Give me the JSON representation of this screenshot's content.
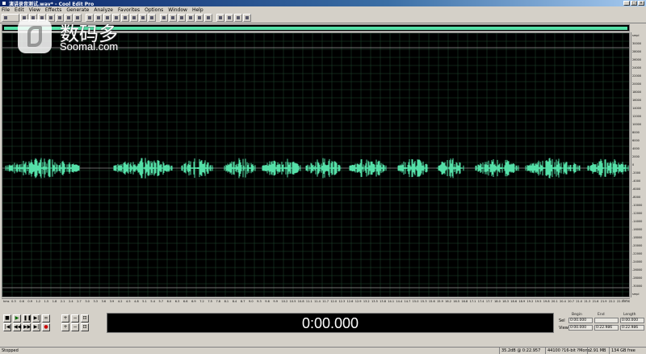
{
  "window": {
    "title": "演讲录音测试.wav* - Cool Edit Pro",
    "min_label": "_",
    "max_label": "□",
    "close_label": "×"
  },
  "menu": [
    "File",
    "Edit",
    "View",
    "Effects",
    "Generate",
    "Analyze",
    "Favorites",
    "Options",
    "Window",
    "Help"
  ],
  "watermark": {
    "brand_cn": "数码多",
    "brand_en": "Soomal.com"
  },
  "colors": {
    "waveform": "#55e0a8",
    "background": "#000000",
    "grid": "#1f4a2e",
    "center_line": "#cfcfcf"
  },
  "vertical_ruler": {
    "ticks": [
      "smpl",
      "30000",
      "28000",
      "26000",
      "24000",
      "22000",
      "20000",
      "18000",
      "16000",
      "14000",
      "12000",
      "10000",
      "8000",
      "6000",
      "4000",
      "2000",
      "0",
      "-2000",
      "-4000",
      "-6000",
      "-8000",
      "-10000",
      "-12000",
      "-14000",
      "-16000",
      "-18000",
      "-20000",
      "-22000",
      "-24000",
      "-26000",
      "-28000",
      "-30000",
      "smpl"
    ]
  },
  "horizontal_ruler": {
    "ticks": [
      "hms",
      "0.3",
      "0.6",
      "0.9",
      "1.2",
      "1.5",
      "1.8",
      "2.1",
      "2.4",
      "2.7",
      "3.0",
      "3.3",
      "3.6",
      "3.9",
      "4.2",
      "4.5",
      "4.8",
      "5.1",
      "5.4",
      "5.7",
      "6.0",
      "6.3",
      "6.6",
      "6.9",
      "7.2",
      "7.5",
      "7.8",
      "8.1",
      "8.4",
      "8.7",
      "9.0",
      "9.3",
      "9.6",
      "9.9",
      "10.2",
      "10.5",
      "10.8",
      "11.1",
      "11.4",
      "11.7",
      "12.0",
      "12.3",
      "12.6",
      "12.9",
      "13.2",
      "13.5",
      "13.8",
      "14.1",
      "14.4",
      "14.7",
      "15.0",
      "15.3",
      "15.6",
      "15.9",
      "16.2",
      "16.5",
      "16.8",
      "17.1",
      "17.4",
      "17.7",
      "18.0",
      "18.3",
      "18.6",
      "18.9",
      "19.2",
      "19.5",
      "19.8",
      "20.1",
      "20.4",
      "20.7",
      "21.0",
      "21.3",
      "21.6",
      "21.9",
      "22.2",
      "22.5"
    ],
    "corner": "hms"
  },
  "time_display": "0:00.000",
  "selection": {
    "headers": [
      "Begin",
      "End",
      "Length"
    ],
    "sel_label": "Sel",
    "view_label": "View",
    "sel": [
      "0:00.000",
      "",
      "0:00.000"
    ],
    "view": [
      "0:00.000",
      "0:22.986",
      "0:22.986"
    ]
  },
  "status": {
    "state": "Stopped",
    "level": "35.2dB @ 0:22.957",
    "format": "44100 ?16-bit ?Mono",
    "size": "2.91 MB",
    "free": "134 GB free"
  },
  "transport_buttons": [
    "stop",
    "play",
    "pause",
    "play-to-end",
    "loop",
    "go-start",
    "rewind",
    "fast-forward",
    "go-end",
    "record",
    "zoom-in",
    "zoom-out",
    "zoom-full",
    "zoom-in-v",
    "zoom-out-v",
    "zoom-sel"
  ]
}
